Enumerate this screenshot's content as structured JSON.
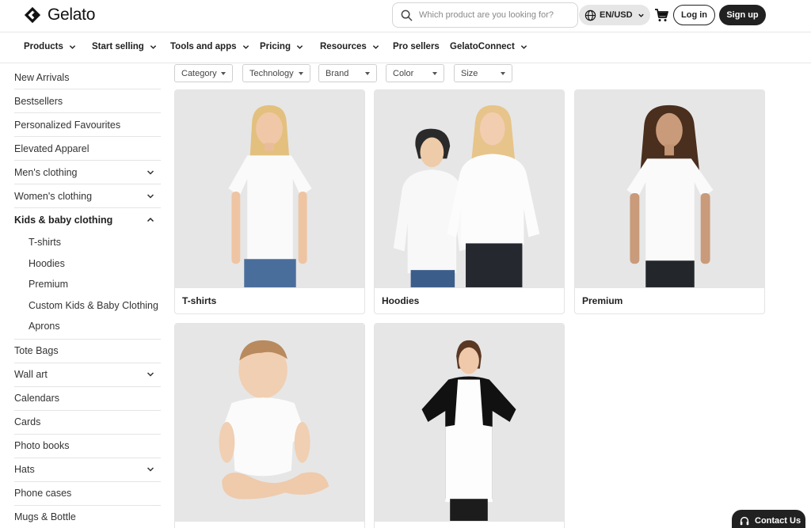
{
  "brand": {
    "name": "Gelato"
  },
  "header": {
    "search_placeholder": "Which product are you looking for?",
    "language": "EN/USD",
    "login_label": "Log in",
    "signup_label": "Sign up"
  },
  "nav": {
    "items": [
      {
        "label": "Products",
        "has_dropdown": true
      },
      {
        "label": "Start selling",
        "has_dropdown": true
      },
      {
        "label": "Tools and apps",
        "has_dropdown": true
      },
      {
        "label": "Pricing",
        "has_dropdown": true
      },
      {
        "label": "Resources",
        "has_dropdown": true
      },
      {
        "label": "Pro sellers",
        "has_dropdown": false
      },
      {
        "label": "GelatoConnect",
        "has_dropdown": true
      }
    ]
  },
  "sidebar": {
    "items": [
      {
        "label": "New Arrivals"
      },
      {
        "label": "Bestsellers"
      },
      {
        "label": "Personalized Favourites"
      },
      {
        "label": "Elevated Apparel"
      },
      {
        "label": "Men's clothing",
        "expandable": true
      },
      {
        "label": "Women's clothing",
        "expandable": true
      },
      {
        "label": "Kids & baby clothing",
        "expandable": true,
        "expanded": true
      }
    ],
    "subitems": [
      {
        "label": "T-shirts"
      },
      {
        "label": "Hoodies"
      },
      {
        "label": "Premium"
      },
      {
        "label": "Custom Kids & Baby Clothing"
      },
      {
        "label": "Aprons"
      }
    ],
    "items_after": [
      {
        "label": "Tote Bags"
      },
      {
        "label": "Wall art",
        "expandable": true
      },
      {
        "label": "Calendars"
      },
      {
        "label": "Cards"
      },
      {
        "label": "Photo books"
      },
      {
        "label": "Hats",
        "expandable": true
      },
      {
        "label": "Phone cases"
      },
      {
        "label": "Mugs & Bottle"
      }
    ]
  },
  "filters": [
    {
      "label": "Category"
    },
    {
      "label": "Technology"
    },
    {
      "label": "Brand"
    },
    {
      "label": "Color"
    },
    {
      "label": "Size"
    }
  ],
  "products": [
    {
      "label": "T-shirts"
    },
    {
      "label": "Hoodies"
    },
    {
      "label": "Premium"
    },
    {
      "label": ""
    },
    {
      "label": ""
    }
  ],
  "contact": {
    "label": "Contact Us"
  },
  "colors": {
    "dark": "#212121",
    "card_bg": "#e6e6e6",
    "border": "#e4e4e4"
  }
}
